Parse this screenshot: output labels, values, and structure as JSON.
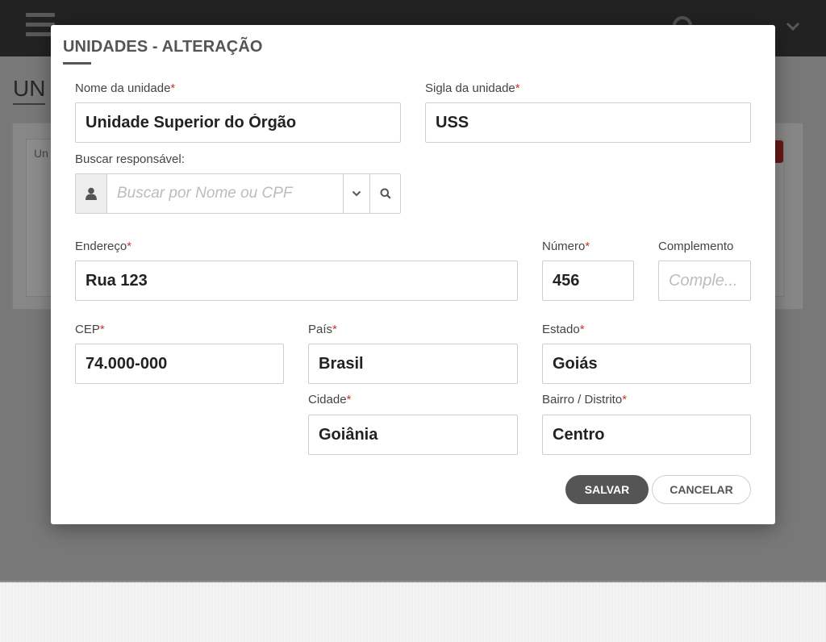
{
  "background": {
    "page_heading": "UN",
    "panel_label": "Un"
  },
  "modal": {
    "title": "UNIDADES - ALTERAÇÃO",
    "fields": {
      "nome": {
        "label": "Nome da unidade",
        "required": "*",
        "value": "Unidade Superior do Órgão"
      },
      "sigla": {
        "label": "Sigla da unidade",
        "required": "*",
        "value": "USS"
      },
      "responsavel": {
        "label": "Buscar responsável:",
        "placeholder": "Buscar por Nome ou CPF"
      },
      "endereco": {
        "label": "Endereço",
        "required": "*",
        "value": "Rua 123"
      },
      "numero": {
        "label": "Número",
        "required": "*",
        "value": "456"
      },
      "complemento": {
        "label": "Complemento",
        "placeholder": "Comple..."
      },
      "cep": {
        "label": "CEP",
        "required": "*",
        "value": "74.000-000"
      },
      "pais": {
        "label": "País",
        "required": "*",
        "value": "Brasil"
      },
      "estado": {
        "label": "Estado",
        "required": "*",
        "value": "Goiás"
      },
      "cidade": {
        "label": "Cidade",
        "required": "*",
        "value": "Goiânia"
      },
      "bairro": {
        "label": "Bairro / Distrito",
        "required": "*",
        "value": "Centro"
      }
    },
    "buttons": {
      "save": "SALVAR",
      "cancel": "CANCELAR"
    }
  },
  "icons": {
    "menu": "hamburger-menu-icon",
    "user": "user-icon",
    "search": "search-icon",
    "chevron": "chevron-down-icon"
  },
  "colors": {
    "required": "#c0392b",
    "save_button": "#555555",
    "header": "#3c3c3c"
  }
}
